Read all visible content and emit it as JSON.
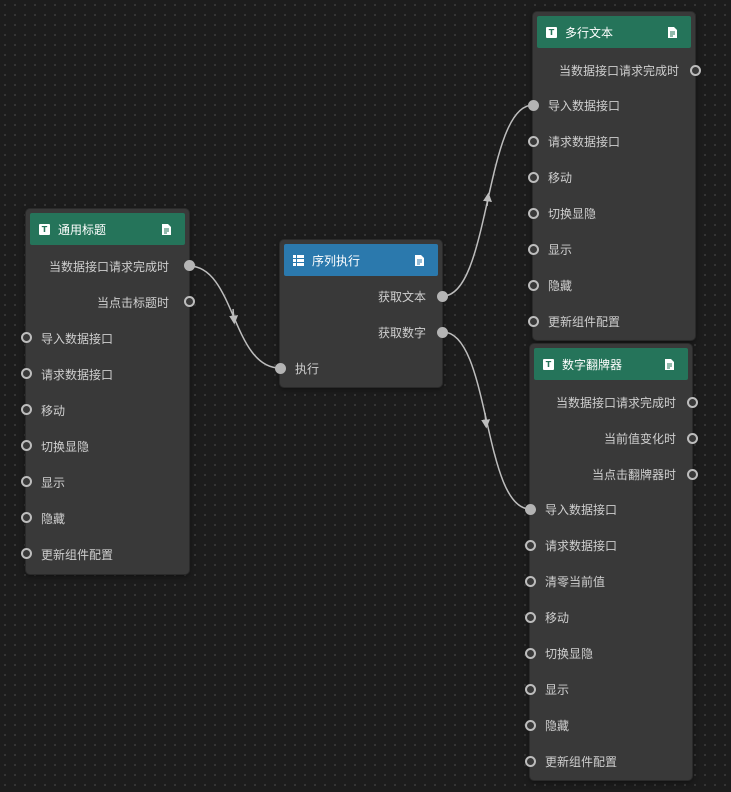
{
  "nodes": {
    "title_node": {
      "title": "通用标题",
      "outputs": [
        "当数据接口请求完成时",
        "当点击标题时"
      ],
      "inputs": [
        "导入数据接口",
        "请求数据接口",
        "移动",
        "切换显隐",
        "显示",
        "隐藏",
        "更新组件配置"
      ]
    },
    "sequence_node": {
      "title": "序列执行",
      "outputs": [
        "获取文本",
        "获取数字"
      ],
      "inputs": [
        "执行"
      ]
    },
    "multiline_text_node": {
      "title": "多行文本",
      "outputs": [
        "当数据接口请求完成时"
      ],
      "inputs": [
        "导入数据接口",
        "请求数据接口",
        "移动",
        "切换显隐",
        "显示",
        "隐藏",
        "更新组件配置"
      ]
    },
    "number_flip_node": {
      "title": "数字翻牌器",
      "outputs": [
        "当数据接口请求完成时",
        "当前值变化时",
        "当点击翻牌器时"
      ],
      "inputs": [
        "导入数据接口",
        "请求数据接口",
        "清零当前值",
        "移动",
        "切换显隐",
        "显示",
        "隐藏",
        "更新组件配置"
      ]
    }
  },
  "colors": {
    "header_green": "#25745a",
    "header_blue": "#2b79ad",
    "node_body": "#393939",
    "wire": "#bdbdbd"
  },
  "icons": {
    "component_header": "text-component-icon",
    "sequence_header": "sequence-icon",
    "header_right": "document-icon"
  }
}
